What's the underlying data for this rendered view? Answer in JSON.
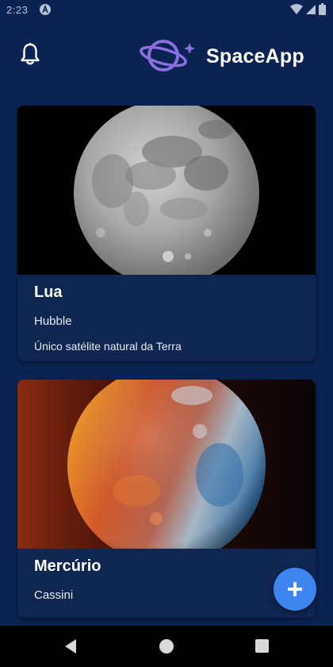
{
  "status_bar": {
    "time": "2:23",
    "app_icon": "a-letter-icon",
    "icons": [
      "wifi-icon",
      "signal-icon",
      "battery-icon"
    ]
  },
  "header": {
    "notification_icon": "bell-icon",
    "logo_icon": "planet-ring-star-icon",
    "app_name": "SpaceApp"
  },
  "cards": [
    {
      "title": "Lua",
      "subtitle": "Hubble",
      "description": "Único satélite natural da Terra",
      "image": "moon-photo"
    },
    {
      "title": "Mercúrio",
      "subtitle": "Cassini",
      "image": "mercury-colored-photo"
    }
  ],
  "fab": {
    "icon": "plus-icon"
  },
  "nav_bar": {
    "icons": [
      "back-triangle-icon",
      "home-circle-icon",
      "recents-square-icon"
    ]
  },
  "colors": {
    "background": "#0a2352",
    "card": "#0e2650",
    "fab": "#3d86f0",
    "logo_accent": "#8b6fe0",
    "text": "#ffffff"
  }
}
